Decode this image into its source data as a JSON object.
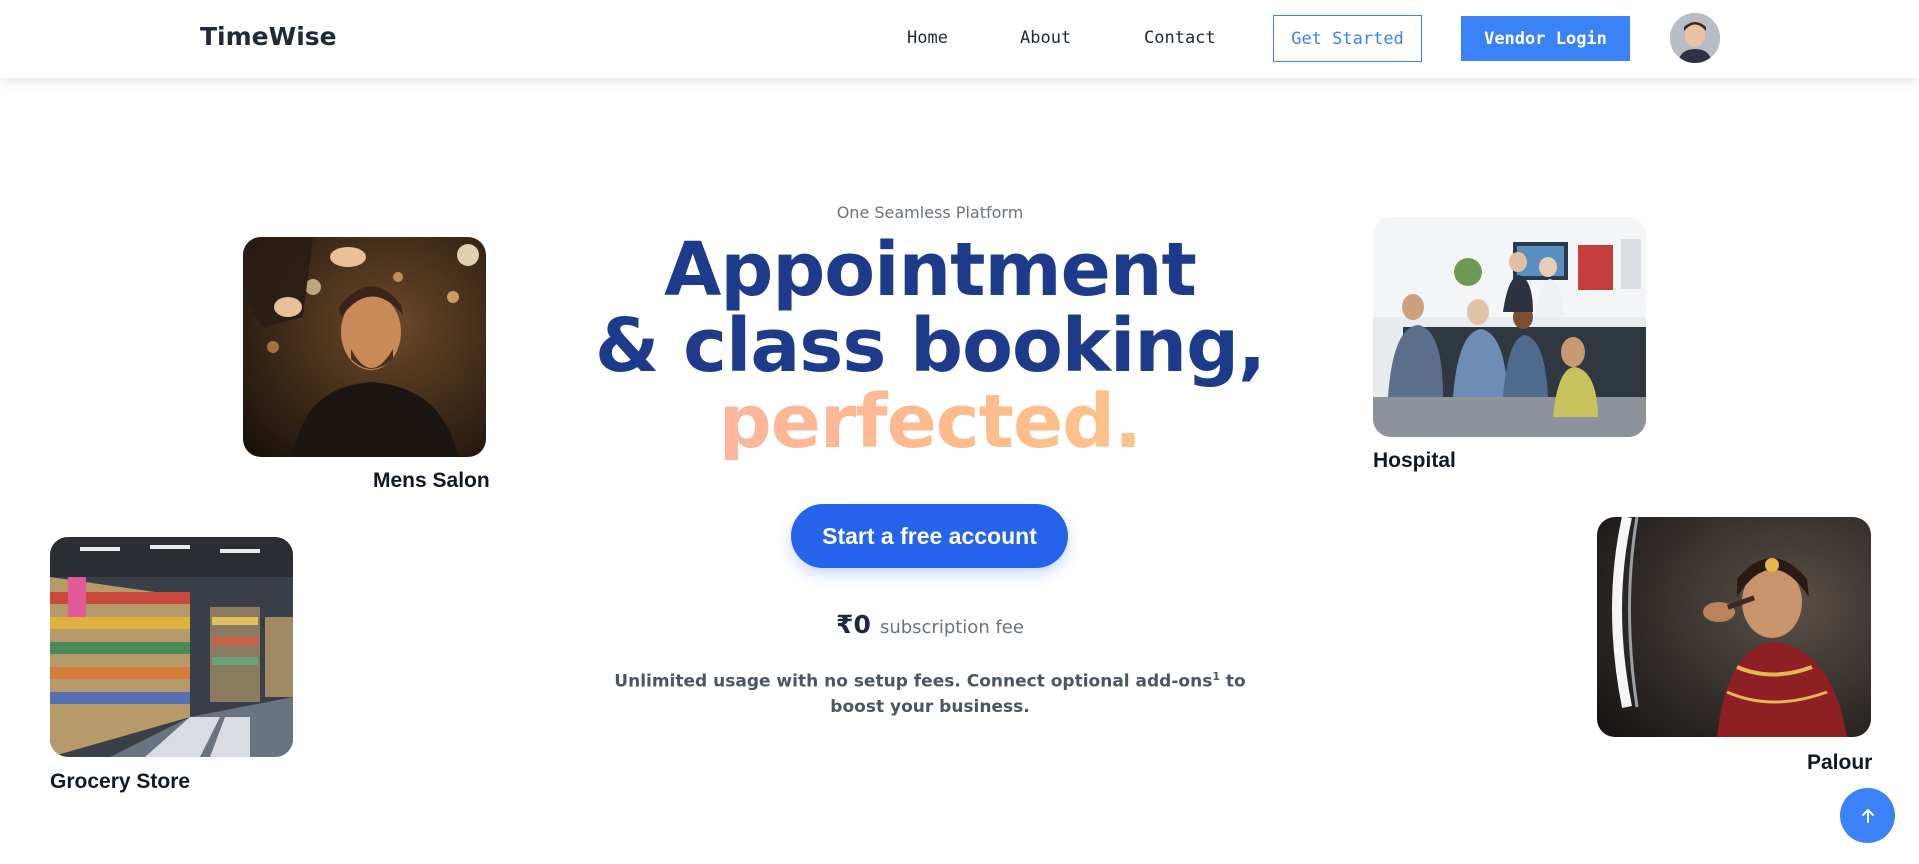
{
  "header": {
    "brand": "TimeWise",
    "nav": [
      "Home",
      "About",
      "Contact"
    ],
    "get_started": "Get Started",
    "vendor_login": "Vendor Login"
  },
  "hero": {
    "eyebrow": "One Seamless Platform",
    "headline_line1": "Appointment",
    "headline_line2": "& class booking,",
    "headline_line3": "perfected.",
    "cta": "Start a free account",
    "price_amount": "₹0",
    "price_label": "subscription fee",
    "subtext_before": "Unlimited usage with no setup fees. Connect optional add-ons",
    "subtext_sup": "1",
    "subtext_after": " to boost your business."
  },
  "cards": {
    "mens_salon": "Mens Salon",
    "hospital": "Hospital",
    "grocery_store": "Grocery Store",
    "palour": "Palour"
  },
  "colors": {
    "primary": "#3b82f6",
    "cta": "#2563eb",
    "headline": "#1e3a8a"
  },
  "icons": {
    "scroll_top": "arrow-up-icon"
  }
}
